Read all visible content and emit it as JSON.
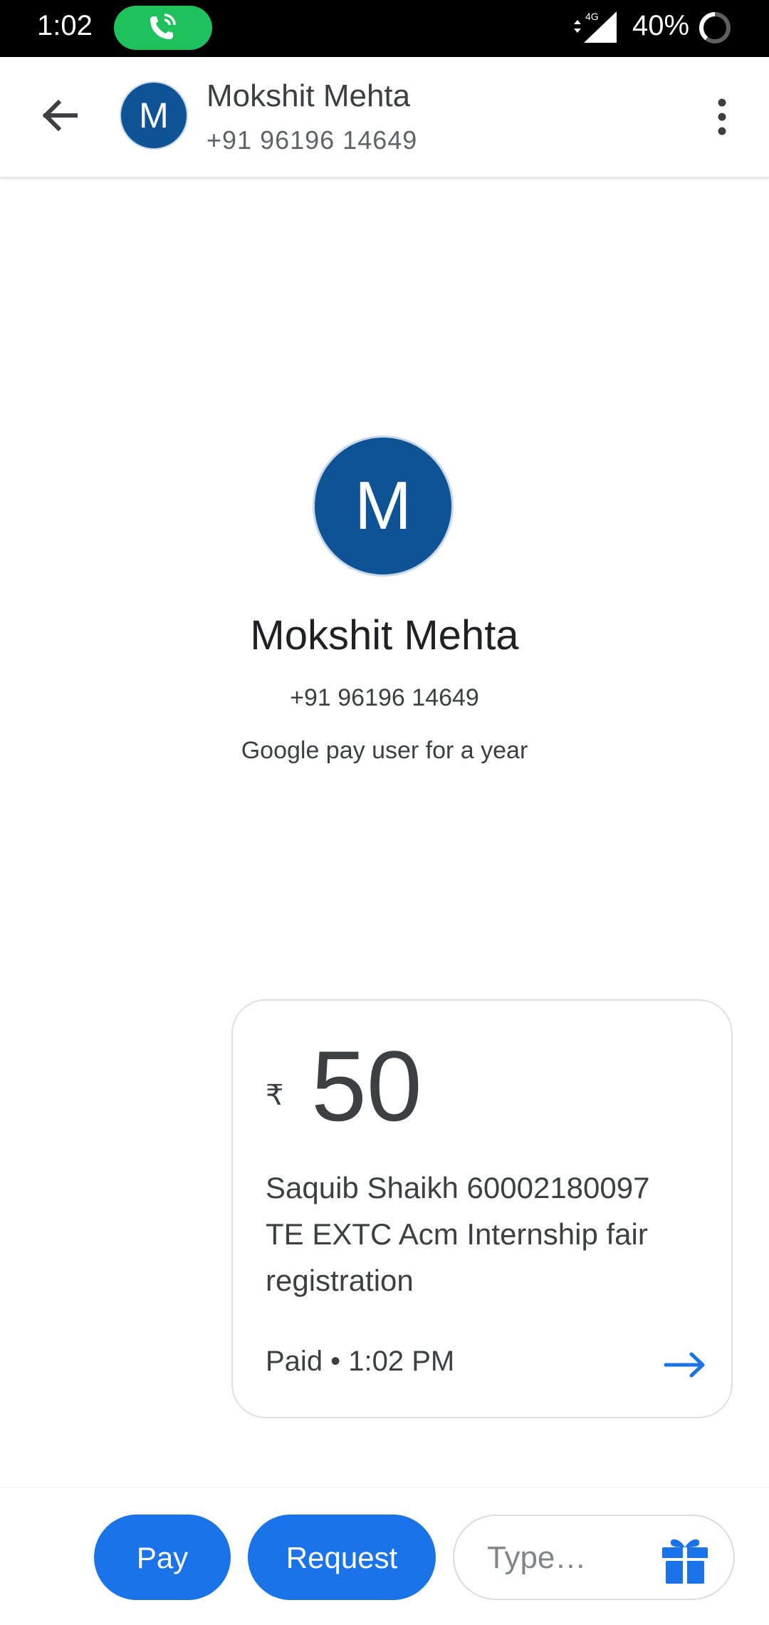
{
  "status_bar": {
    "time": "1:02",
    "network": "4G",
    "battery": "40%"
  },
  "header": {
    "avatar_initial": "M",
    "name": "Mokshit Mehta",
    "phone": "+91 96196 14649"
  },
  "profile": {
    "avatar_initial": "M",
    "name": "Mokshit Mehta",
    "phone": "+91 96196 14649",
    "since": "Google pay user for a year"
  },
  "payment": {
    "currency_symbol": "₹",
    "amount": "50",
    "note": "Saquib Shaikh 60002180097 TE EXTC Acm Internship fair registration",
    "status": "Paid • 1:02 PM"
  },
  "bottom_bar": {
    "pay_label": "Pay",
    "request_label": "Request",
    "type_placeholder": "Type…"
  },
  "colors": {
    "accent": "#1a73e8",
    "avatar": "#0d5396",
    "call_pill": "#1ec25c"
  }
}
